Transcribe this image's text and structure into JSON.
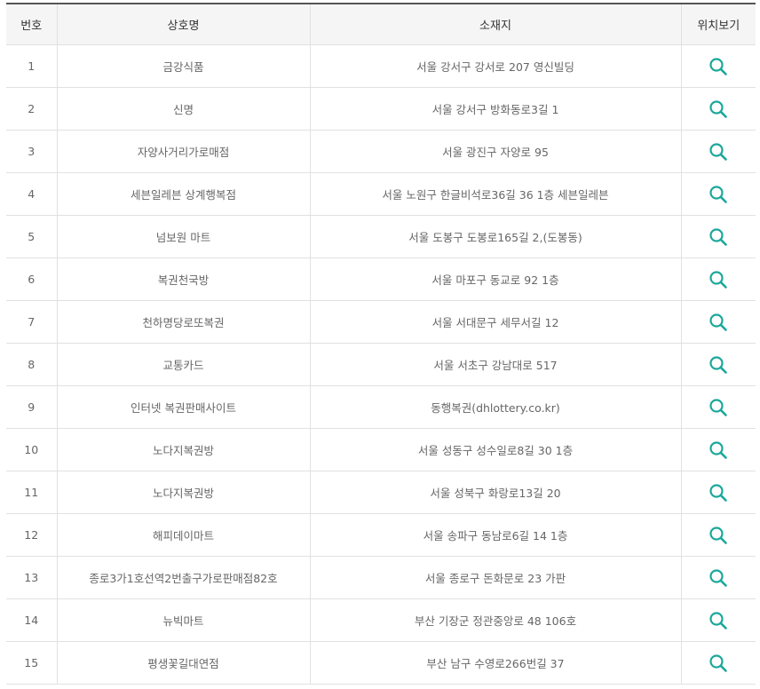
{
  "table": {
    "headers": {
      "num": "번호",
      "name": "상호명",
      "address": "소재지",
      "map": "위치보기"
    },
    "icon": "search-icon",
    "accent_color": "#1aa89a",
    "rows": [
      {
        "num": "1",
        "name": "금강식품",
        "address": "서울 강서구 강서로 207 영신빌딩"
      },
      {
        "num": "2",
        "name": "신명",
        "address": "서울 강서구 방화동로3길 1"
      },
      {
        "num": "3",
        "name": "자양사거리가로매점",
        "address": "서울 광진구 자양로 95"
      },
      {
        "num": "4",
        "name": "세븐일레븐 상계행복점",
        "address": "서울 노원구 한글비석로36길 36 1층 세븐일레븐"
      },
      {
        "num": "5",
        "name": "넘보원 마트",
        "address": "서울 도봉구 도봉로165길 2,(도봉동)"
      },
      {
        "num": "6",
        "name": "복권천국방",
        "address": "서울 마포구 동교로 92 1층"
      },
      {
        "num": "7",
        "name": "천하명당로또복권",
        "address": "서울 서대문구 세무서길 12"
      },
      {
        "num": "8",
        "name": "교통카드",
        "address": "서울 서초구 강남대로 517"
      },
      {
        "num": "9",
        "name": "인터넷 복권판매사이트",
        "address": "동행복권(dhlottery.co.kr)"
      },
      {
        "num": "10",
        "name": "노다지복권방",
        "address": "서울 성동구 성수일로8길 30 1층"
      },
      {
        "num": "11",
        "name": "노다지복권방",
        "address": "서울 성북구 화랑로13길 20"
      },
      {
        "num": "12",
        "name": "해피데이마트",
        "address": "서울 송파구 동남로6길 14 1층"
      },
      {
        "num": "13",
        "name": "종로3가1호선역2번출구가로판매점82호",
        "address": "서울 종로구 돈화문로 23 가판"
      },
      {
        "num": "14",
        "name": "뉴빅마트",
        "address": "부산 기장군 정관중앙로 48 106호"
      },
      {
        "num": "15",
        "name": "평생꽃길대연점",
        "address": "부산 남구 수영로266번길 37"
      }
    ]
  }
}
